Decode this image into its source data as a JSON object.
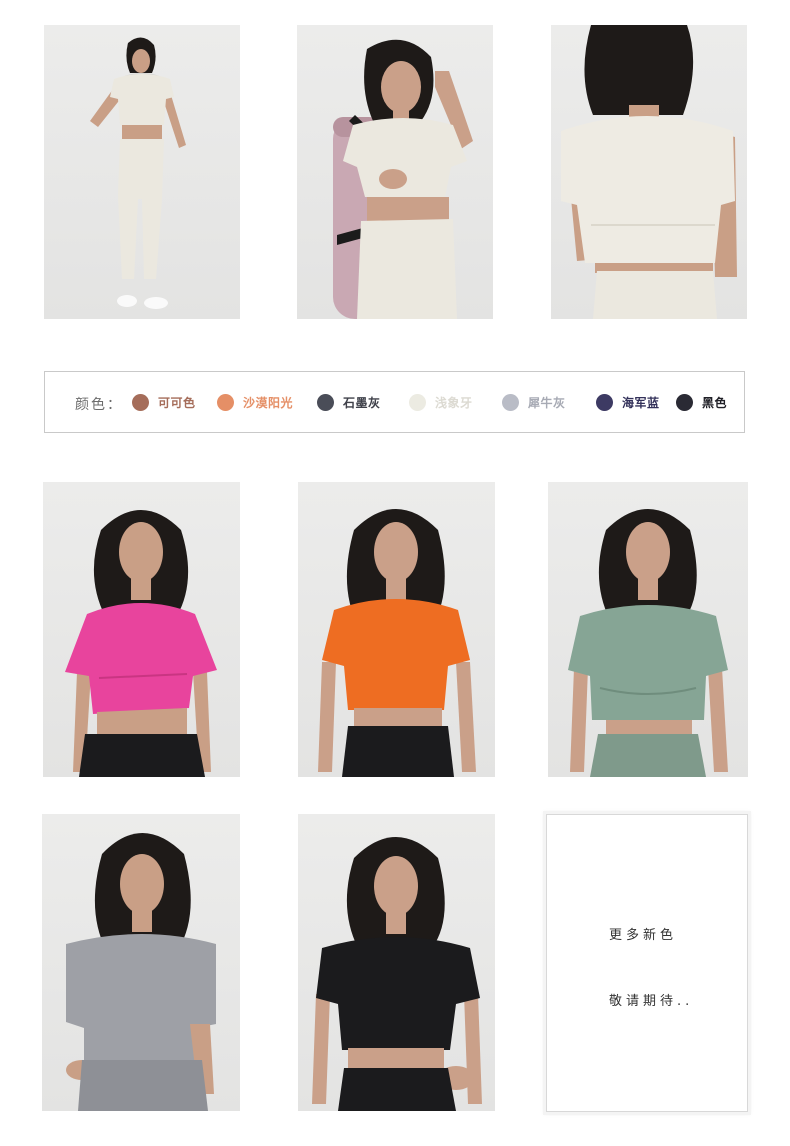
{
  "colors": {
    "cocoa": "#a56d5a",
    "sand": "#e58f66",
    "stone_gray": "#4a4d58",
    "ivory": "#ecebe2",
    "rhino_gray": "#b9bcc6",
    "navy": "#3d3a63",
    "black": "#2a2a34",
    "pink_top": "#e8449d",
    "orange_top": "#ee6d22",
    "green_top": "#86a595",
    "gray_top": "#9ea0a6",
    "black_top": "#1b1b1d",
    "cream_top": "#ebe8df"
  },
  "legend": {
    "label": "颜色：",
    "items": [
      {
        "name": "可可色",
        "text_color": "#a56d5a"
      },
      {
        "name": "沙漠阳光",
        "text_color": "#e58f66"
      },
      {
        "name": "石墨灰",
        "text_color": "#3f414a"
      },
      {
        "name": "浅象牙",
        "text_color": "#dcdad2"
      },
      {
        "name": "犀牛灰",
        "text_color": "#a7aab4"
      },
      {
        "name": "海军蓝",
        "text_color": "#33315a"
      },
      {
        "name": "黑色",
        "text_color": "#1f1f26"
      }
    ]
  },
  "more_card": {
    "line1": "更多新色",
    "line2": "敬请期待.."
  }
}
